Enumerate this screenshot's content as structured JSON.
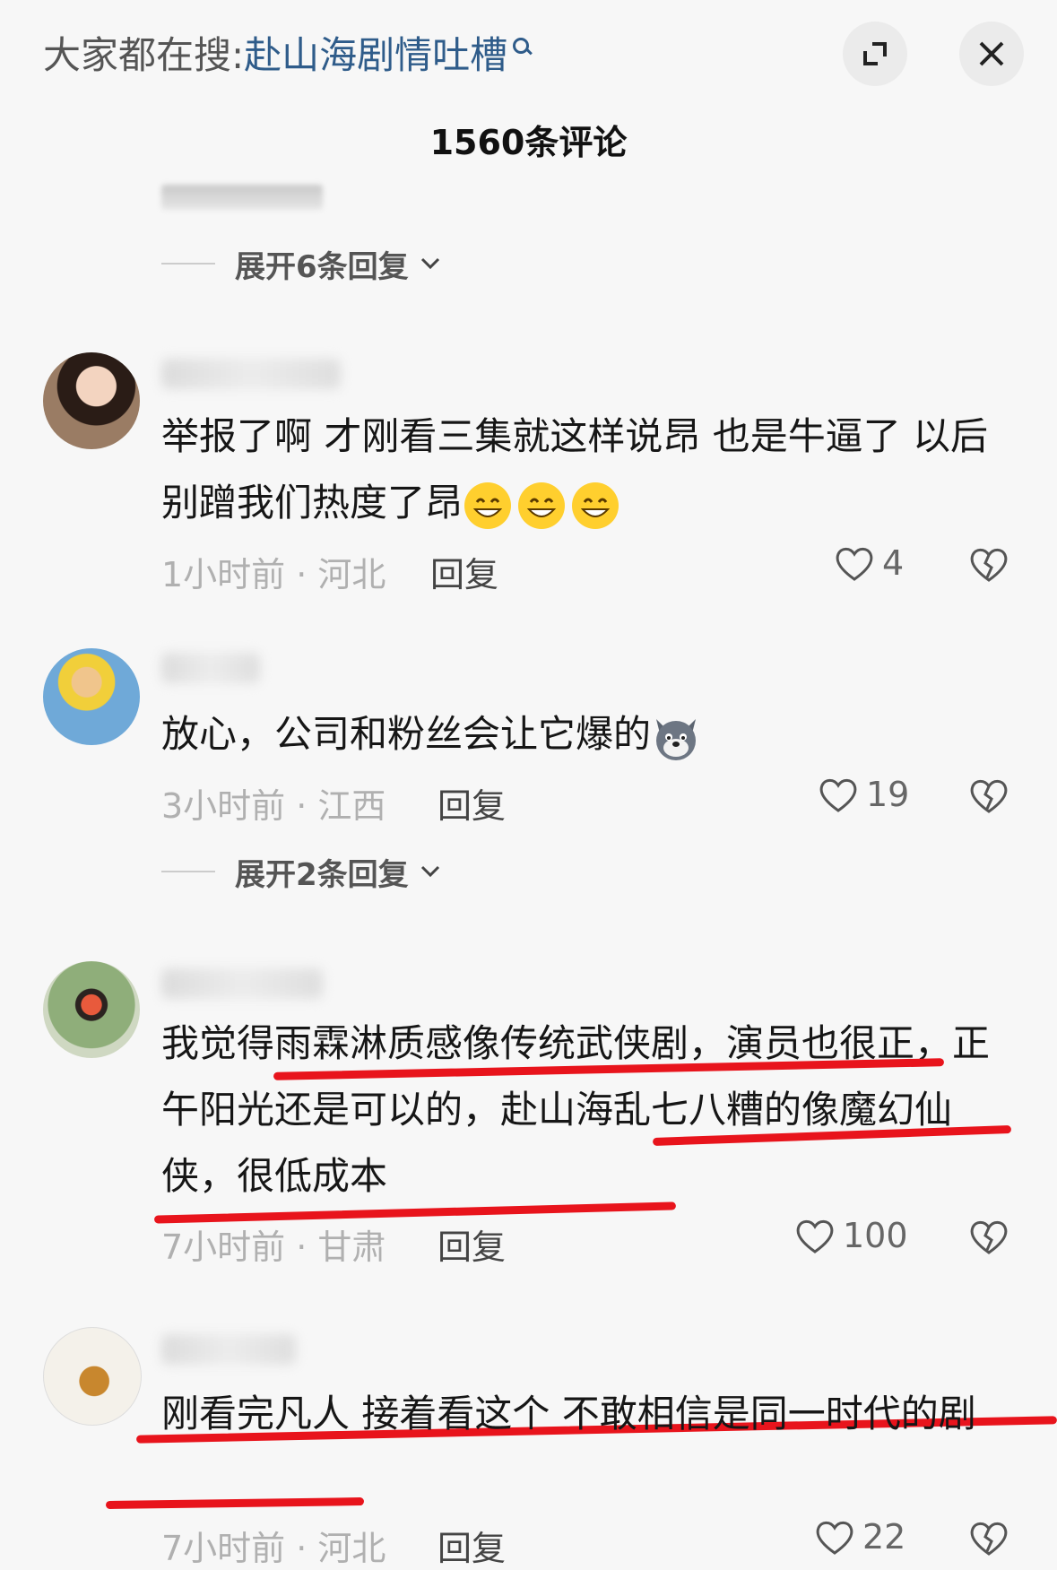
{
  "header": {
    "search_prefix": "大家都在搜:",
    "search_query": "赴山海剧情吐槽",
    "comment_count": "1560条评论"
  },
  "expand_replies_top": "展开6条回复",
  "expand_replies_mid": "展开2条回复",
  "comments": [
    {
      "content": "举报了啊 才刚看三集就这样说昂 也是牛逼了 以后别蹭我们热度了昂",
      "time_location": "1小时前 · 河北",
      "reply": "回复",
      "likes": "4"
    },
    {
      "content": "放心，公司和粉丝会让它爆的",
      "time_location": "3小时前 · 江西",
      "reply": "回复",
      "likes": "19"
    },
    {
      "content": "我觉得雨霖淋质感像传统武侠剧，演员也很正，正午阳光还是可以的，赴山海乱七八糟的像魔幻仙侠，很低成本",
      "time_location": "7小时前 · 甘肃",
      "reply": "回复",
      "likes": "100"
    },
    {
      "content": "刚看完凡人 接着看这个 不敢相信是同一时代的剧",
      "time_location": "7小时前 · 河北",
      "reply": "回复",
      "likes": "22"
    }
  ],
  "colors": {
    "accent_query": "#2f5c8a",
    "annotation_red": "#e8141c",
    "background": "#f7f7f7"
  },
  "icons": [
    "search-icon",
    "expand-icon",
    "close-icon",
    "chevron-down-icon",
    "heart-icon",
    "broken-heart-icon",
    "grin-emoji",
    "wolf-emoji"
  ]
}
